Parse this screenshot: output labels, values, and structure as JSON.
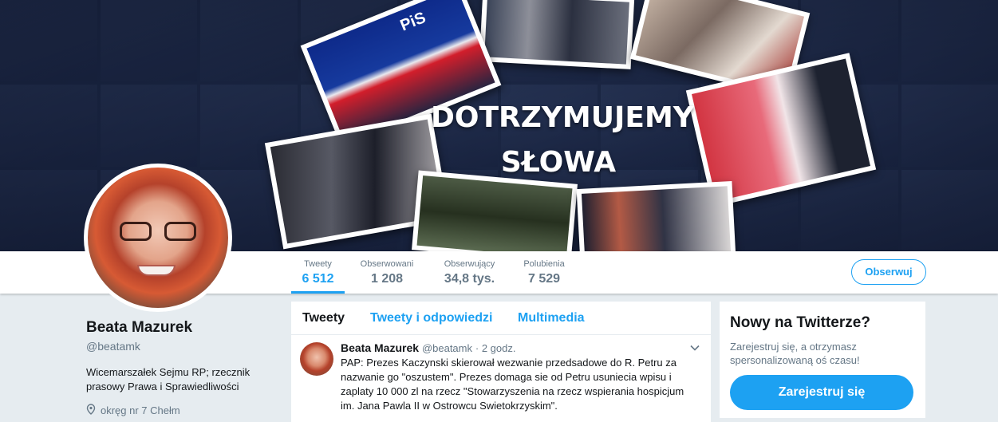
{
  "banner": {
    "slogan_line1": "DOTRZYMUJEMY",
    "slogan_line2": "SŁOWA",
    "logo_text": "PiS"
  },
  "stats": [
    {
      "label": "Tweety",
      "value": "6 512"
    },
    {
      "label": "Obserwowani",
      "value": "1 208"
    },
    {
      "label": "Obserwujący",
      "value": "34,8 tys."
    },
    {
      "label": "Polubienia",
      "value": "7 529"
    }
  ],
  "follow_label": "Obserwuj",
  "profile": {
    "name": "Beata Mazurek",
    "handle": "@beatamk",
    "bio": "Wicemarszałek Sejmu RP; rzecznik prasowy Prawa i Sprawiedliwości",
    "location": "okręg nr 7 Chełm"
  },
  "tabs": [
    "Tweety",
    "Tweety i odpowiedzi",
    "Multimedia"
  ],
  "tweet": {
    "name": "Beata Mazurek",
    "handle": "@beatamk",
    "time": "· 2 godz.",
    "text": "PAP: Prezes Kaczynski skierował wezwanie przedsadowe do R. Petru za nazwanie go \"oszustem\". Prezes domaga sie od Petru usuniecia wpisu i zaplaty 10 000 zl na rzecz \"Stowarzyszenia na rzecz wspierania hospicjum im. Jana Pawla II w Ostrowcu Swietokrzyskim\"."
  },
  "sidebar": {
    "heading": "Nowy na Twitterze?",
    "subtext": "Zarejestruj się, a otrzymasz spersonalizowaną oś czasu!",
    "signup_label": "Zarejestruj się"
  },
  "colors": {
    "accent": "#1da1f2",
    "muted": "#657786",
    "background": "#e6ecf0"
  }
}
